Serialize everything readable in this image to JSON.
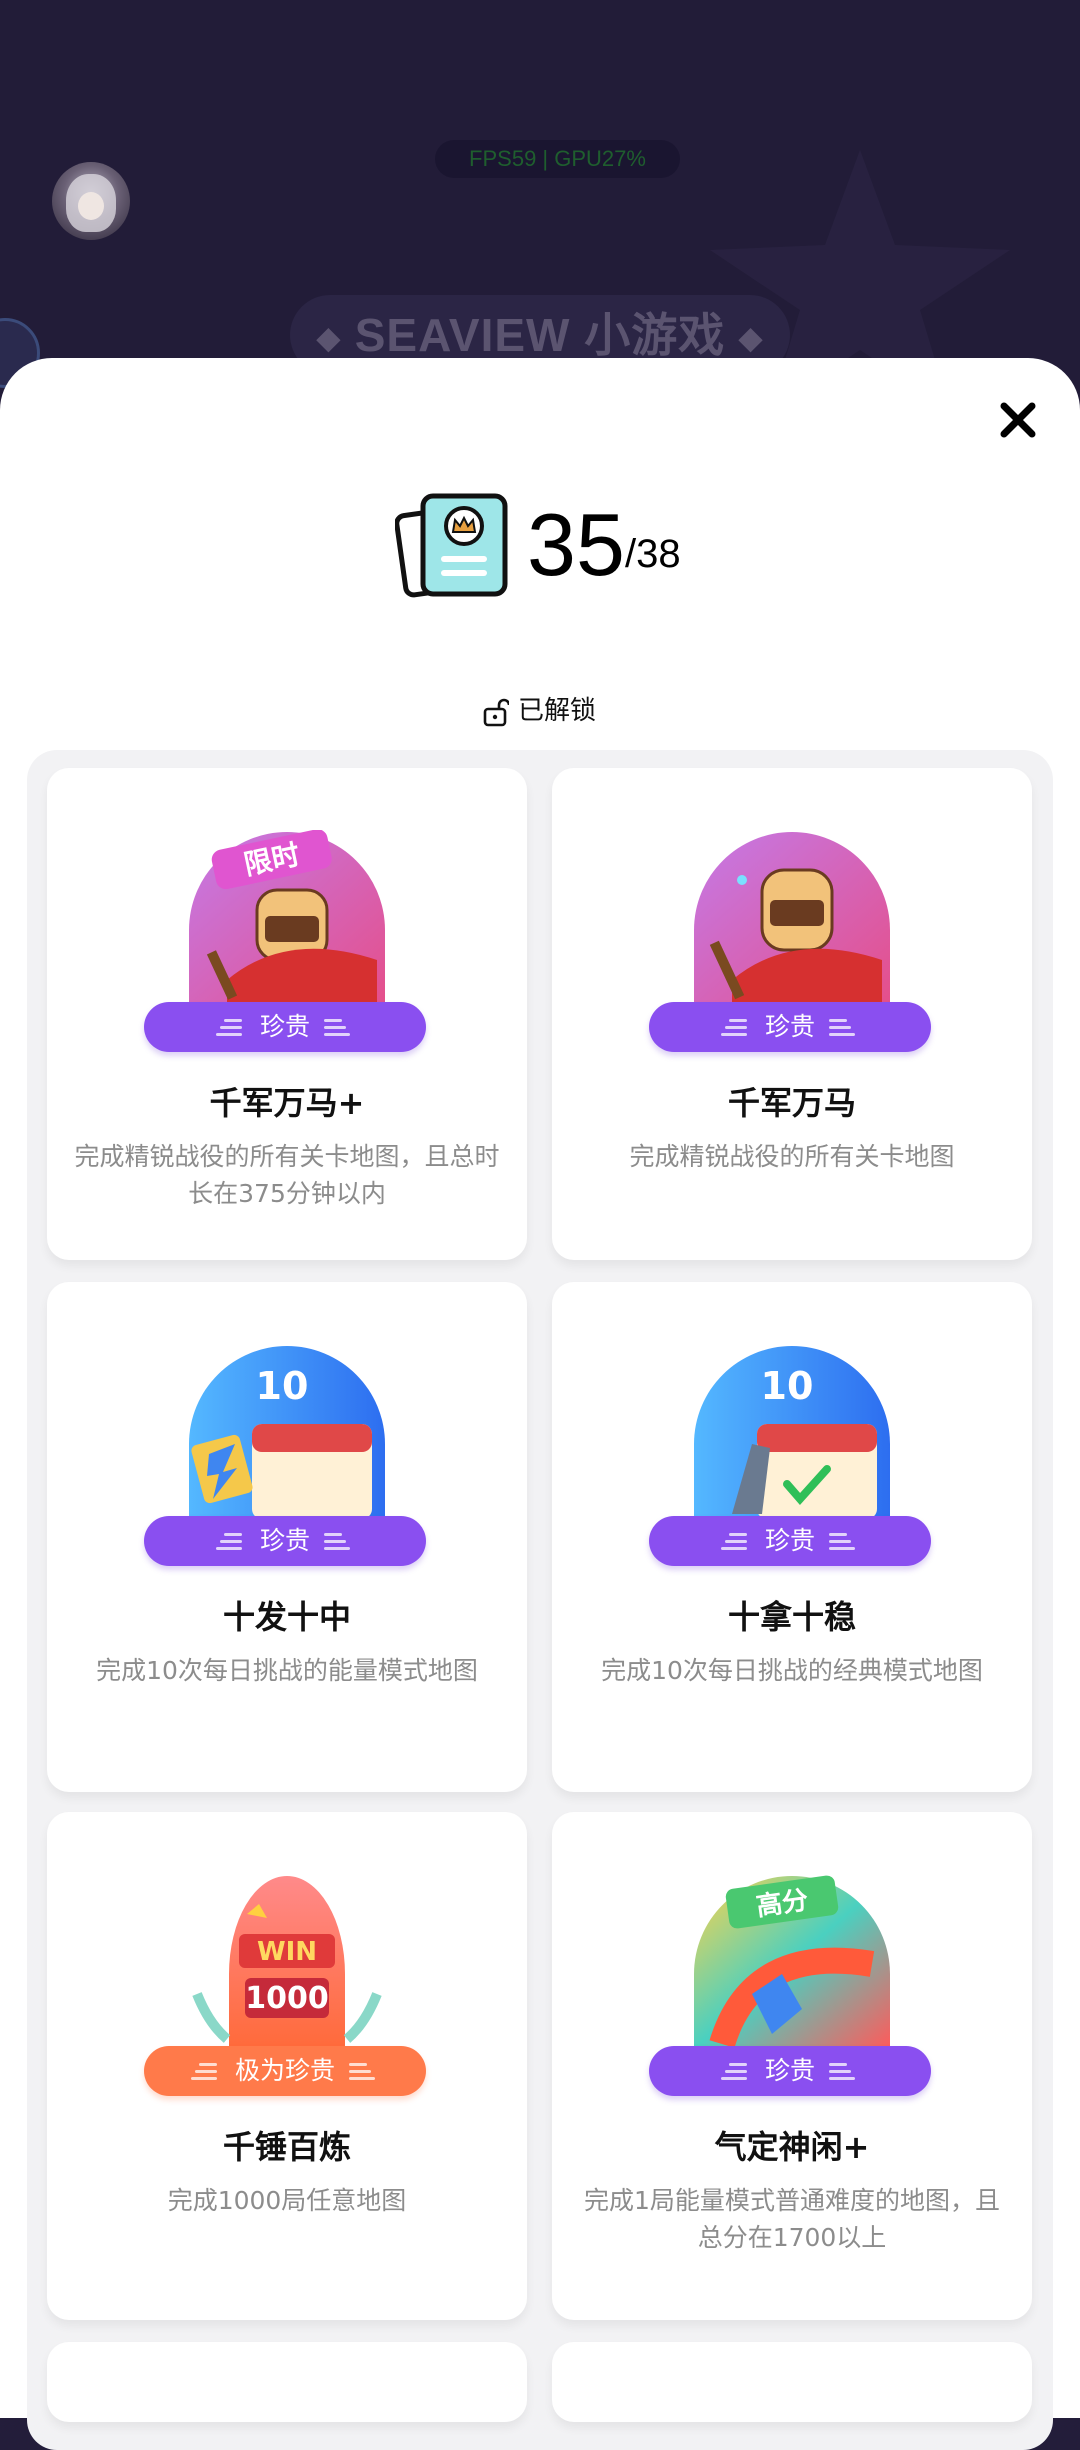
{
  "header": {
    "fps_label": "FPS59 | GPU27%",
    "banner_title": "SEAVIEW 小游戏",
    "banner_ornament_left": "◆",
    "banner_ornament_right": "◆"
  },
  "sheet": {
    "close_icon": "close-icon",
    "count_unlocked": "35",
    "count_total": "/38",
    "unlock_section_label": "已解锁"
  },
  "achievements": [
    {
      "title": "千军万马+",
      "description": "完成精锐战役的所有关卡地图，且总时长在375分钟以内",
      "rarity": "珍贵",
      "badge_tag": "限时",
      "badge_theme": "knight"
    },
    {
      "title": "千军万马",
      "description": "完成精锐战役的所有关卡地图",
      "rarity": "珍贵",
      "badge_theme": "knight"
    },
    {
      "title": "十发十中",
      "description": "完成10次每日挑战的能量模式地图",
      "rarity": "珍贵",
      "badge_number": "10",
      "badge_theme": "calendar-energy"
    },
    {
      "title": "十拿十稳",
      "description": "完成10次每日挑战的经典模式地图",
      "rarity": "珍贵",
      "badge_number": "10",
      "badge_theme": "calendar-classic"
    },
    {
      "title": "千锤百炼",
      "description": "完成1000局任意地图",
      "rarity": "极为珍贵",
      "badge_win": "WIN",
      "badge_number": "1000",
      "badge_theme": "win-1000"
    },
    {
      "title": "气定神闲+",
      "description": "完成1局能量模式普通难度的地图，且总分在1700以上",
      "rarity": "珍贵",
      "badge_tag": "高分",
      "badge_theme": "high-score"
    }
  ],
  "colors": {
    "rarity_precious": "#8a4ff0",
    "rarity_very_precious": "#ff7a4a",
    "top_background": "#221c38"
  }
}
